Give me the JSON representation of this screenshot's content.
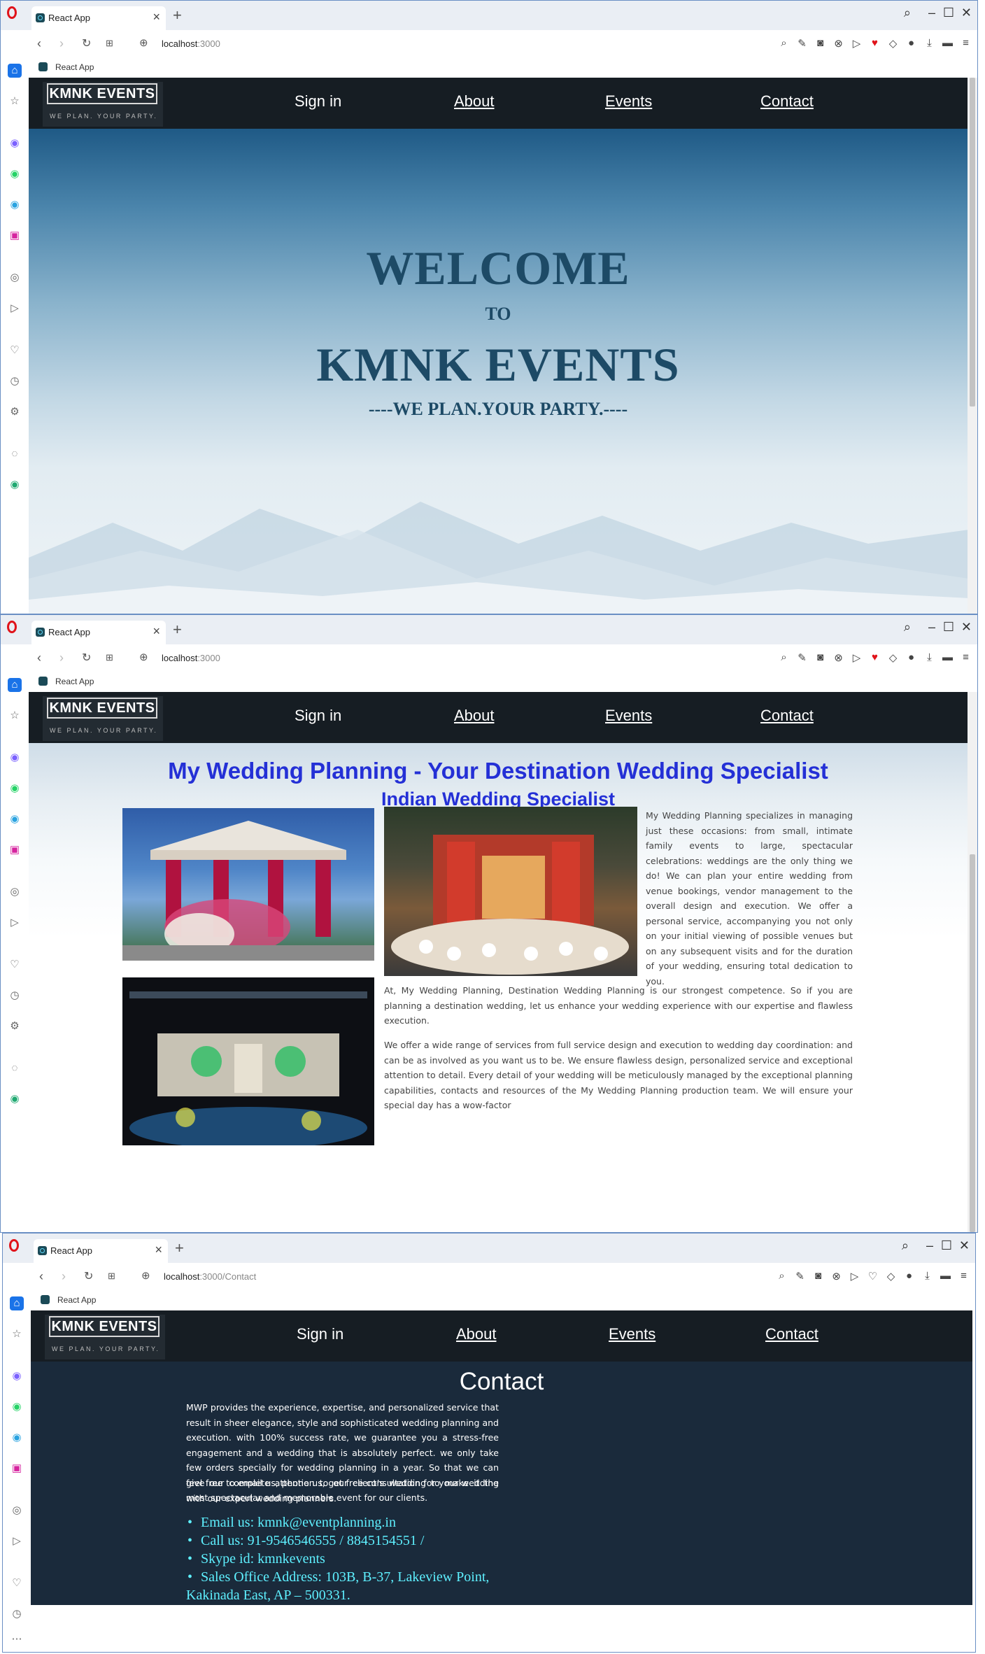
{
  "browser": {
    "tab_title": "React App",
    "url_host": "localhost",
    "url_path_home": ":3000",
    "url_path_contact": ":3000/Contact",
    "bookmark_label": "React App"
  },
  "app": {
    "logo_name": "KMNK EVENTS",
    "logo_tagline": "WE PLAN. YOUR PARTY.",
    "nav": {
      "signin": "Sign in",
      "about": "About",
      "events": "Events",
      "contact": "Contact"
    }
  },
  "hero": {
    "line1": "WELCOME",
    "line2": "TO",
    "line3": "KMNK EVENTS",
    "line4": "----WE PLAN.YOUR PARTY.----"
  },
  "wedding": {
    "title": "My Wedding Planning - Your Destination Wedding Specialist",
    "subtitle": "Indian Wedding Specialist",
    "para1": "My Wedding Planning specializes in managing just these occasions: from small, intimate family events to large, spectacular celebrations: weddings are the only thing we do! We can plan your entire wedding from venue bookings, vendor management to the overall design and execution. We offer a personal service, accompanying you not only on your initial viewing of possible venues but on any subsequent visits and for the duration of your wedding, ensuring total dedication to you.",
    "para2": "At, My Wedding Planning, Destination Wedding Planning is our strongest competence. So if you are planning a destination wedding, let us enhance your wedding experience with our expertise and flawless execution.",
    "para3": "We offer a wide range of services from full service design and execution to wedding day coordination: and can be as involved as you want us to be. We ensure flawless design, personalized service and exceptional attention to detail. Every detail of your wedding will be meticulously managed by the exceptional planning capabilities, contacts and resources of the My Wedding Planning production team. We will ensure your special day has a wow-factor"
  },
  "contact": {
    "title": "Contact",
    "para1": "MWP provides the experience, expertise, and personalized service that result in sheer elegance, style and sophisticated wedding planning and execution. with 100% success rate, we guarantee you a stress-free engagement and a wedding that is absolutely perfect. we only take few orders specially for wedding planning in a year. So that we can give our complete attention to our client’s wedding to make it the most spectacular and memorable event for our clients.",
    "para2": "feel free to email us, phone us, get free consultation for your wedding with our expert wedding planners.",
    "items": [
      "Email us: kmnk@eventplanning.in",
      "Call us: 91-9546546555 / 8845154551 /",
      "Skype id: kmnkevents",
      "Sales Office Address: 103B, B-37, Lakeview Point, Kakinada East, AP – 500331."
    ]
  },
  "icons": {
    "sidebar": [
      "home-icon",
      "star-icon",
      "messenger-icon",
      "whatsapp-icon",
      "telegram-icon",
      "instagram-icon",
      "player-icon",
      "send-icon",
      "heart-icon",
      "history-icon",
      "settings-icon",
      "bulb-icon",
      "aria-icon"
    ],
    "toolbar": [
      "find-icon",
      "edit-icon",
      "camera-icon",
      "adblock-icon",
      "flow-icon",
      "heart-icon",
      "cube-icon",
      "profile-icon",
      "download-icon",
      "battery-icon",
      "menu-icon"
    ]
  },
  "colors": {
    "navbar": "#161d23",
    "heading_blue": "#2430d6",
    "contact_bg": "#1a2a3b",
    "contact_list": "#5ef0ff",
    "hero_text": "#1d4a66"
  }
}
